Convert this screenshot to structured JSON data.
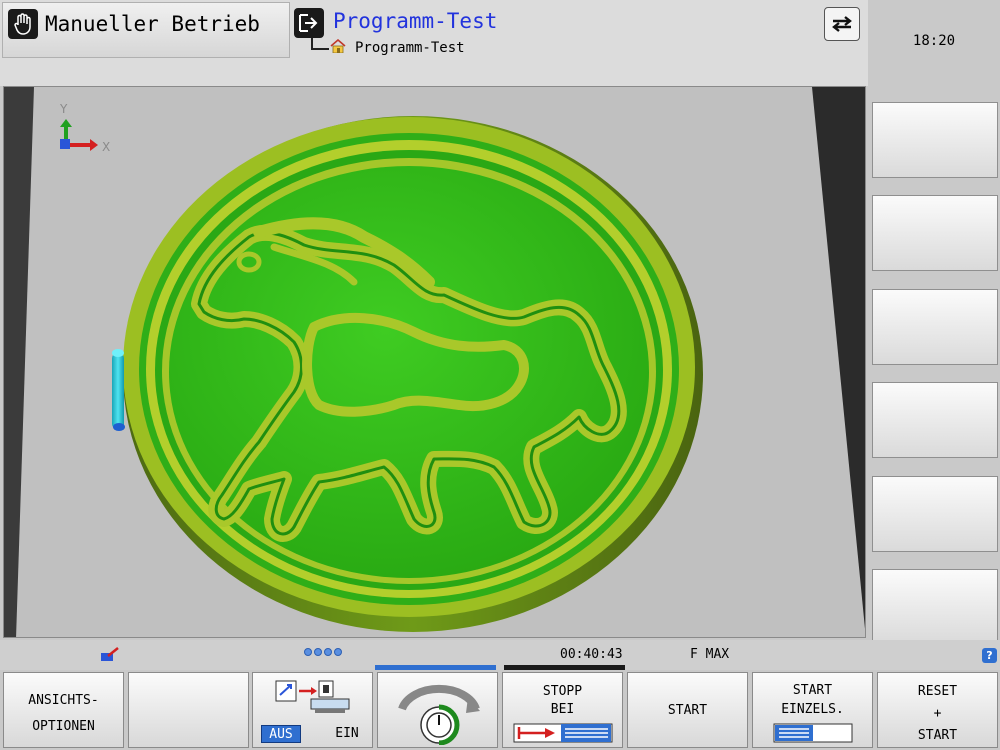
{
  "header": {
    "mode_label": "Manueller Betrieb",
    "program_title": "Programm-Test",
    "program_sub": "Programm-Test"
  },
  "clock": "18:20",
  "status": {
    "time": "00:40:43",
    "feed": "F MAX",
    "help": "?"
  },
  "viewport": {
    "axis_x": "X",
    "axis_y": "Y",
    "workpiece_color": "#33bb1a",
    "groove_color": "#a9c82a",
    "tool_color": "#22c6d8",
    "background": "#c0c0c0"
  },
  "softkeys": {
    "ansichts_l1": "ANSICHTS-",
    "ansichts_l2": "OPTIONEN",
    "aus": "AUS",
    "ein": "EIN",
    "stopp_l1": "STOPP",
    "stopp_l2": "BEI",
    "start": "START",
    "einzel_l1": "START",
    "einzel_l2": "EINZELS.",
    "reset_l1": "RESET",
    "reset_l2": "+",
    "reset_l3": "START"
  }
}
